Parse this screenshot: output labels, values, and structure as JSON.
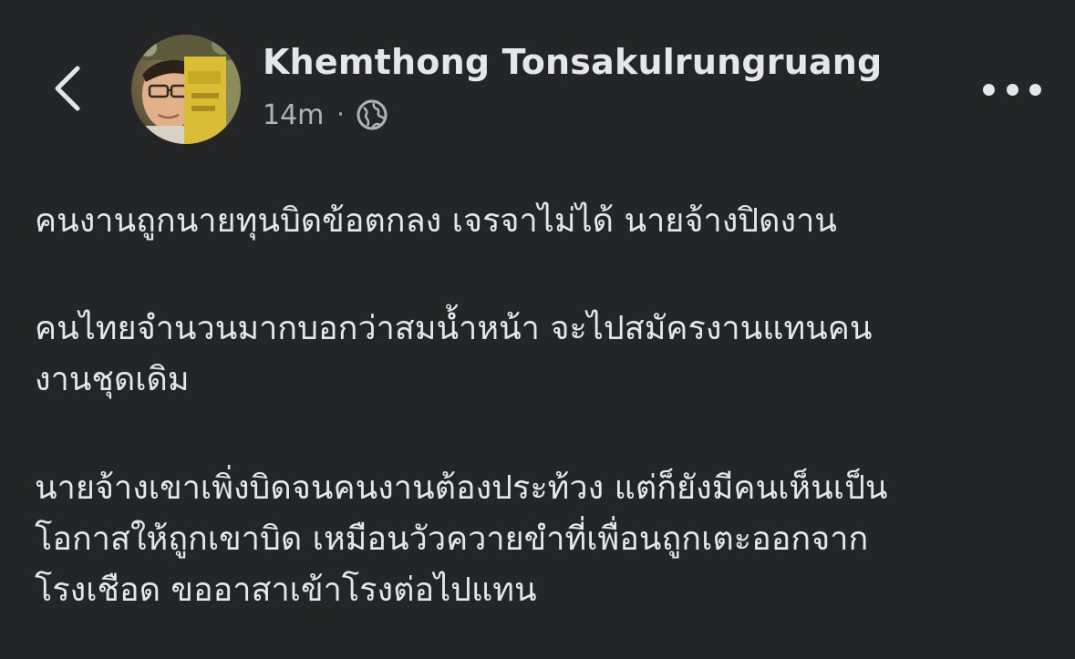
{
  "header": {
    "author_name": "Khemthong Tonsakulrungruang",
    "timestamp": "14m",
    "separator": "·",
    "audience_icon": "globe-icon",
    "back_icon": "chevron-left-icon",
    "more_icon": "more-horizontal-icon"
  },
  "post": {
    "paragraphs": [
      [
        "คนงานถูกนายทุนบิดข้อตกลง เจรจาไม่ได้ นายจ้างปิดงาน"
      ],
      [
        "คนไทยจำนวนมากบอกว่าสมน้ำหน้า จะไปสมัครงานแทนคน",
        "งานชุดเดิม"
      ],
      [
        "นายจ้างเขาเพิ่งบิดจนคนงานต้องประท้วง แต่ก็ยังมีคนเห็นเป็น",
        "โอกาสให้ถูกเขาบิด เหมือนวัวควายขำที่เพื่อนถูกเตะออกจาก",
        "โรงเชือด ขออาสาเข้าโรงต่อไปแทน"
      ]
    ]
  },
  "colors": {
    "background": "#242526",
    "primary_text": "#e4e6eb",
    "secondary_text": "#b0b3b8"
  }
}
